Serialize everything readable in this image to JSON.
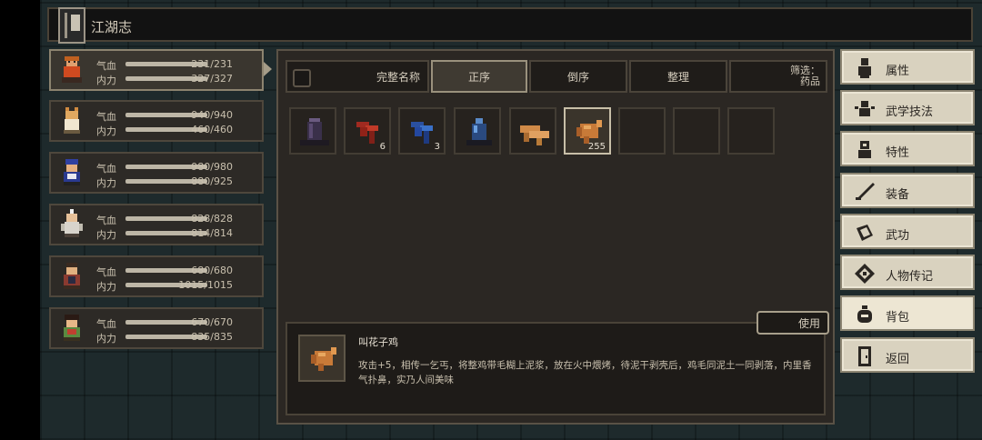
{
  "header": {
    "title": "江湖志"
  },
  "characters": [
    {
      "hp_label": "气血",
      "hp": "231/231",
      "mp_label": "内力",
      "mp": "327/327",
      "active": true
    },
    {
      "hp_label": "气血",
      "hp": "940/940",
      "mp_label": "内力",
      "mp": "460/460"
    },
    {
      "hp_label": "气血",
      "hp": "980/980",
      "mp_label": "内力",
      "mp": "880/925"
    },
    {
      "hp_label": "气血",
      "hp": "828/828",
      "mp_label": "内力",
      "mp": "814/814"
    },
    {
      "hp_label": "气血",
      "hp": "680/680",
      "mp_label": "内力",
      "mp": "1015/1015"
    },
    {
      "hp_label": "气血",
      "hp": "670/670",
      "mp_label": "内力",
      "mp": "835/835"
    }
  ],
  "sort_bar": {
    "full_name": "完整名称",
    "ascending": "正序",
    "descending": "倒序",
    "organize": "整理",
    "filter_label": "筛选：",
    "filter_value": "药品"
  },
  "inventory": [
    {
      "icon": "pot-icon",
      "count": ""
    },
    {
      "icon": "red-herb-icon",
      "count": "6"
    },
    {
      "icon": "blue-herb-icon",
      "count": "3"
    },
    {
      "icon": "blue-vial-icon",
      "count": ""
    },
    {
      "icon": "mushroom-icon",
      "count": ""
    },
    {
      "icon": "roast-chicken-icon",
      "count": "255",
      "selected": true
    }
  ],
  "detail": {
    "name": "叫花子鸡",
    "description": "攻击+5，相传一乞丐，将整鸡带毛糊上泥浆，放在火中煨烤，待泥干剥壳后，鸡毛同泥土一同剥落，内里香气扑鼻，实乃人间美味",
    "use_label": "使用"
  },
  "menu": [
    {
      "label": "属性",
      "icon": "figure-icon"
    },
    {
      "label": "武学技法",
      "icon": "martial-skill-icon"
    },
    {
      "label": "特性",
      "icon": "trait-icon"
    },
    {
      "label": "装备",
      "icon": "sword-icon"
    },
    {
      "label": "武功",
      "icon": "manual-icon"
    },
    {
      "label": "人物传记",
      "icon": "biography-icon"
    },
    {
      "label": "背包",
      "icon": "bag-icon",
      "active": true
    },
    {
      "label": "返回",
      "icon": "exit-door-icon"
    }
  ],
  "colors": {
    "panel": "#2b2723",
    "menu_bg": "#d9d2bf",
    "accent_border": "#c8bfa8"
  }
}
